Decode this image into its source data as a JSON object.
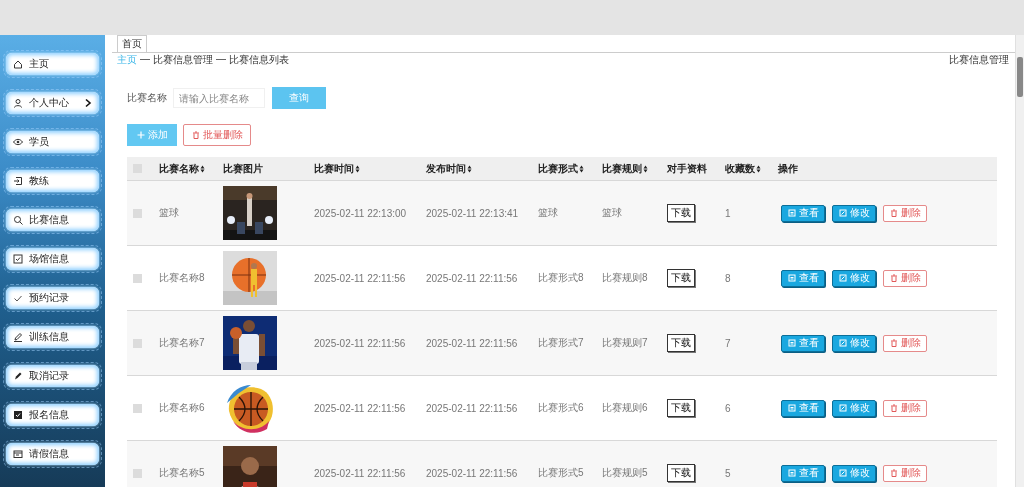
{
  "sidebar": {
    "items": [
      {
        "label": "主页",
        "has_submenu": false
      },
      {
        "label": "个人中心",
        "has_submenu": true
      },
      {
        "label": "学员",
        "has_submenu": false
      },
      {
        "label": "教练",
        "has_submenu": false
      },
      {
        "label": "比赛信息",
        "has_submenu": false
      },
      {
        "label": "场馆信息",
        "has_submenu": false
      },
      {
        "label": "预约记录",
        "has_submenu": false
      },
      {
        "label": "训练信息",
        "has_submenu": false
      },
      {
        "label": "取消记录",
        "has_submenu": false
      },
      {
        "label": "报名信息",
        "has_submenu": false
      },
      {
        "label": "请假信息",
        "has_submenu": false
      }
    ]
  },
  "tabs": [
    {
      "label": "首页",
      "selected": true
    }
  ],
  "breadcrumb": {
    "items": [
      "主页",
      "比赛信息管理",
      "比赛信息列表"
    ],
    "separator": "—"
  },
  "page_title": "比赛信息管理",
  "search": {
    "label": "比赛名称",
    "placeholder": "请输入比赛名称",
    "button": "查询"
  },
  "actions": {
    "add": "添加",
    "batch_delete": "批量删除"
  },
  "table": {
    "header_checked": false,
    "columns": [
      {
        "label": "比赛名称",
        "sortable": true
      },
      {
        "label": "比赛图片",
        "sortable": false
      },
      {
        "label": "比赛时间",
        "sortable": true
      },
      {
        "label": "发布时间",
        "sortable": true
      },
      {
        "label": "比赛形式",
        "sortable": true
      },
      {
        "label": "比赛规则",
        "sortable": true
      },
      {
        "label": "对手资料",
        "sortable": false
      },
      {
        "label": "收藏数",
        "sortable": true
      },
      {
        "label": "操作",
        "sortable": false
      }
    ],
    "rows": [
      {
        "checked": false,
        "name": "篮球",
        "match_time": "2025-02-11 22:13:00",
        "publish_time": "2025-02-11 22:13:41",
        "form": "篮球",
        "rule": "篮球",
        "download": "下载",
        "favorites": "1",
        "buttons": [
          "查看",
          "修改",
          "删除"
        ]
      },
      {
        "checked": false,
        "name": "比赛名称8",
        "match_time": "2025-02-11 22:11:56",
        "publish_time": "2025-02-11 22:11:56",
        "form": "比赛形式8",
        "rule": "比赛规则8",
        "download": "下载",
        "favorites": "8",
        "buttons": [
          "查看",
          "修改",
          "删除"
        ]
      },
      {
        "checked": false,
        "name": "比赛名称7",
        "match_time": "2025-02-11 22:11:56",
        "publish_time": "2025-02-11 22:11:56",
        "form": "比赛形式7",
        "rule": "比赛规则7",
        "download": "下载",
        "favorites": "7",
        "buttons": [
          "查看",
          "修改",
          "删除"
        ]
      },
      {
        "checked": false,
        "name": "比赛名称6",
        "match_time": "2025-02-11 22:11:56",
        "publish_time": "2025-02-11 22:11:56",
        "form": "比赛形式6",
        "rule": "比赛规则6",
        "download": "下载",
        "favorites": "6",
        "buttons": [
          "查看",
          "修改",
          "删除"
        ]
      },
      {
        "checked": false,
        "name": "比赛名称5",
        "match_time": "2025-02-11 22:11:56",
        "publish_time": "2025-02-11 22:11:56",
        "form": "比赛形式5",
        "rule": "比赛规则5",
        "download": "下载",
        "favorites": "5",
        "buttons": [
          "查看",
          "修改",
          "删除"
        ]
      }
    ]
  }
}
